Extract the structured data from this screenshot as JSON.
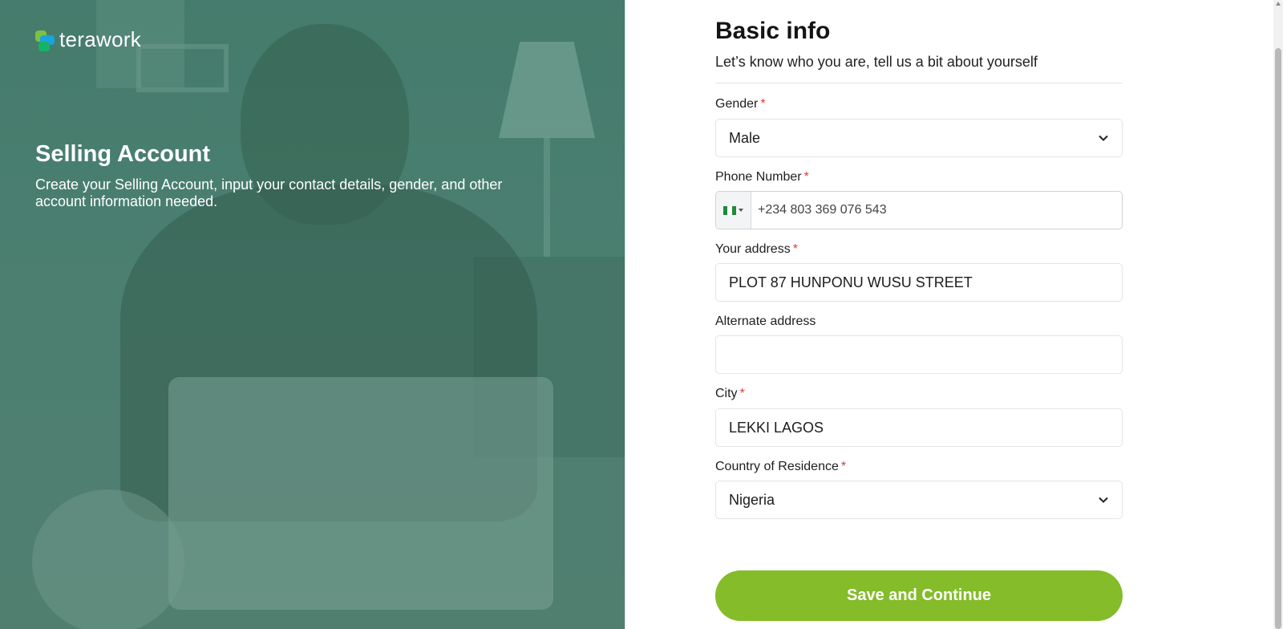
{
  "brand": {
    "name": "terawork"
  },
  "hero": {
    "title": "Selling Account",
    "description": "Create your Selling Account, input your contact details, gender, and other account information needed."
  },
  "form": {
    "title": "Basic info",
    "subtitle": "Let’s know who you are, tell us a bit about yourself",
    "required_marker": "*",
    "gender": {
      "label": "Gender",
      "value": "Male"
    },
    "phone": {
      "label": "Phone Number",
      "placeholder": "+234 803 369 076 543",
      "country_flag": "nigeria-flag-icon"
    },
    "address": {
      "label": "Your address",
      "value": "PLOT 87 HUNPONU WUSU STREET"
    },
    "alternate_address": {
      "label": "Alternate address",
      "value": ""
    },
    "city": {
      "label": "City",
      "value": "LEKKI LAGOS"
    },
    "country": {
      "label": "Country of Residence",
      "value": "Nigeria"
    },
    "submit_label": "Save and Continue"
  },
  "colors": {
    "accent": "#84bc2a",
    "required": "#e53935",
    "hero_overlay": "#4f8574"
  }
}
